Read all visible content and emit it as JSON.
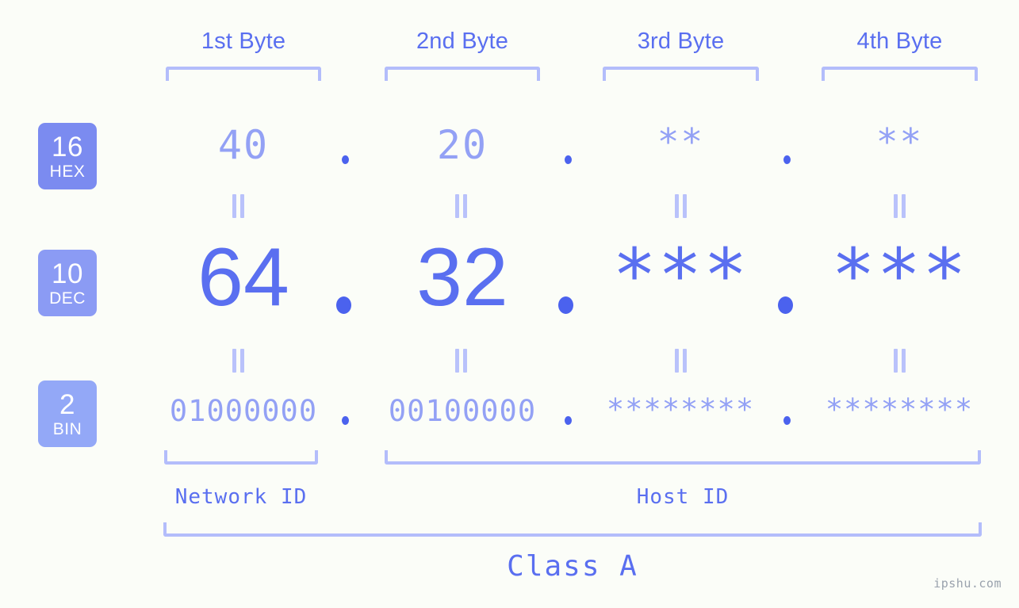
{
  "meta": {
    "background_color": "#fbfdf8",
    "accent_strong": "#4b62ee",
    "accent_mid": "#5a6ff0",
    "accent_light": "#93a1f5",
    "accent_pale": "#b3bdfb"
  },
  "headers": {
    "byte1": "1st Byte",
    "byte2": "2nd Byte",
    "byte3": "3rd Byte",
    "byte4": "4th Byte"
  },
  "badges": [
    {
      "num": "16",
      "name": "HEX",
      "color": "#7b8bf0"
    },
    {
      "num": "10",
      "name": "DEC",
      "color": "#8b9bf4"
    },
    {
      "num": "2",
      "name": "BIN",
      "color": "#93a8f7"
    }
  ],
  "rows": {
    "hex": {
      "label_num": "16",
      "label_name": "HEX",
      "values": [
        "40",
        "20",
        "**",
        "**"
      ],
      "separator": "."
    },
    "dec": {
      "label_num": "10",
      "label_name": "DEC",
      "values": [
        "64",
        "32",
        "***",
        "***"
      ],
      "separator": "."
    },
    "bin": {
      "label_num": "2",
      "label_name": "BIN",
      "values": [
        "01000000",
        "00100000",
        "********",
        "********"
      ],
      "separator": "."
    }
  },
  "equals_marks": {
    "glyph": "||",
    "count_per_row": 4
  },
  "footer": {
    "network_id": "Network ID",
    "host_id": "Host ID",
    "class": "Class A"
  },
  "watermark": "ipshu.com"
}
